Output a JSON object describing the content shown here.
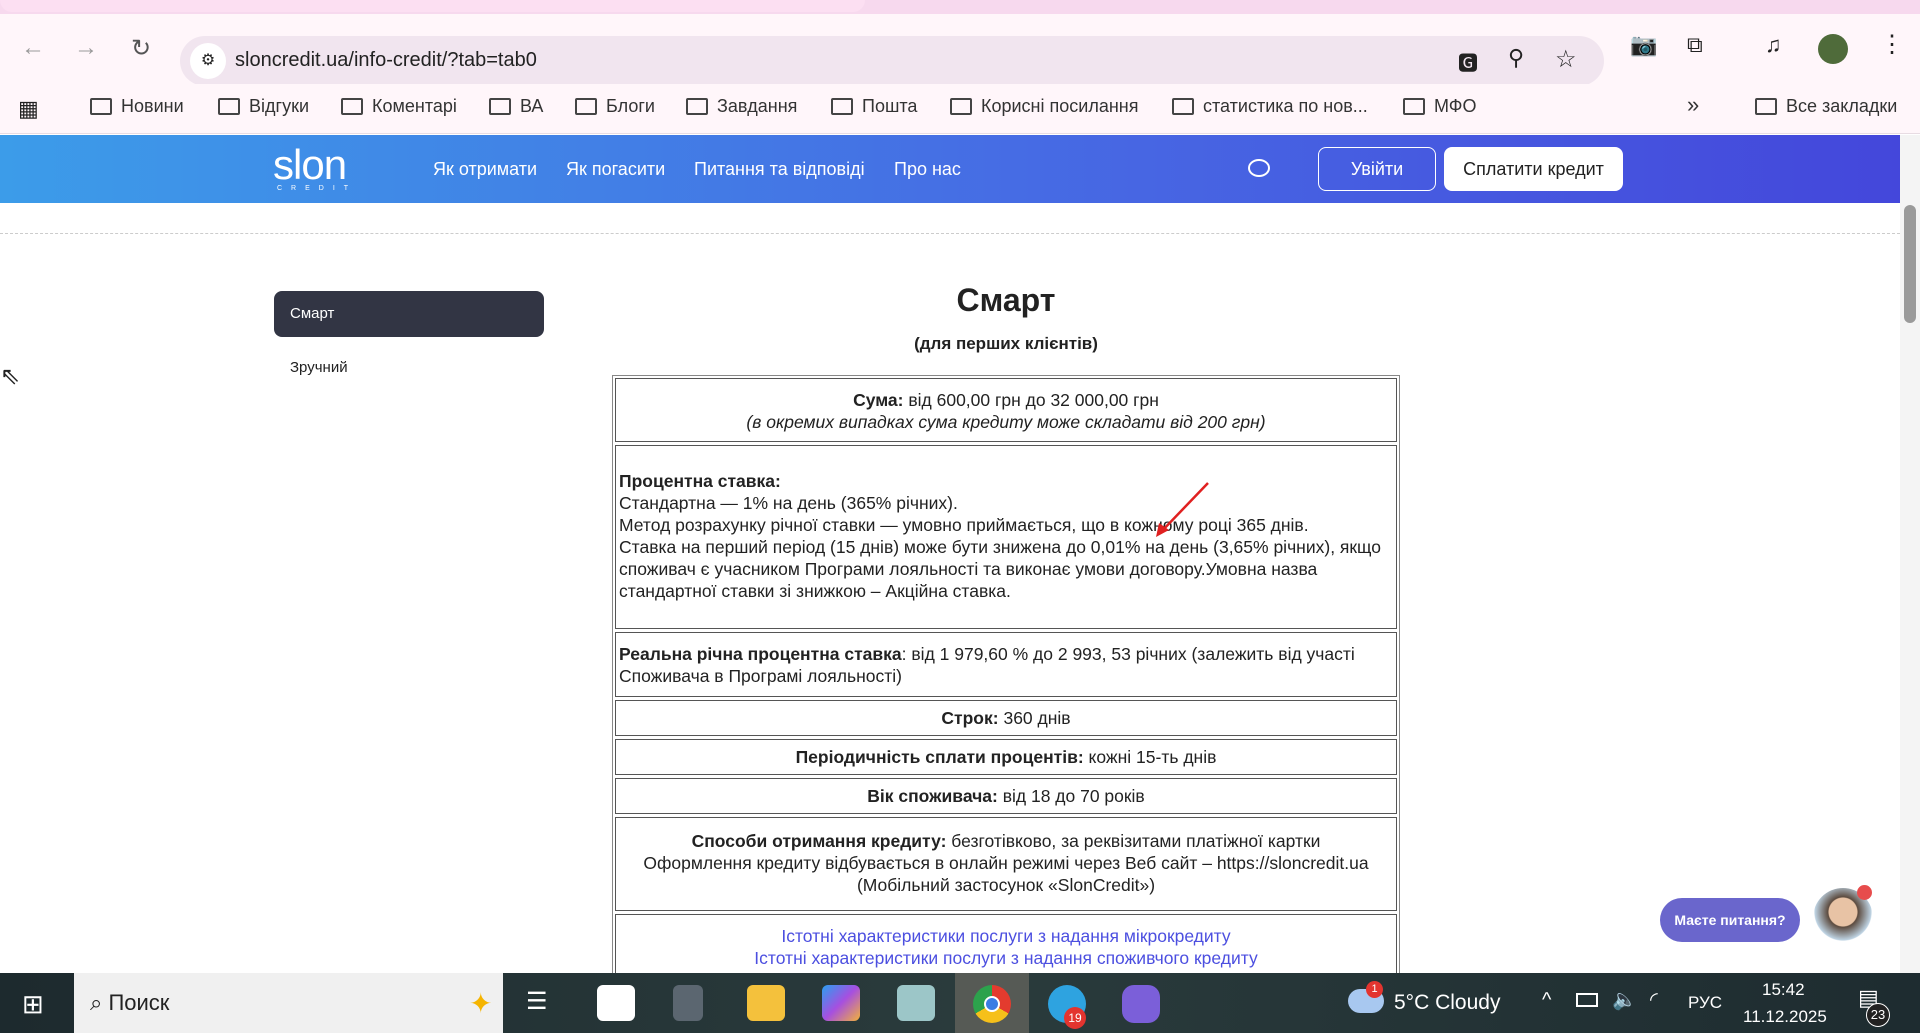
{
  "browser": {
    "url": "sloncredit.ua/info-credit/?tab=tab0",
    "bookmarks": [
      "Новини",
      "Відгуки",
      "Коментарі",
      "ВА",
      "Блоги",
      "Завдання",
      "Пошта",
      "Корисні посилання",
      "статистика по нов...",
      "МФО"
    ],
    "all_bookmarks": "Все закладки",
    "more": "»"
  },
  "site": {
    "logo": "slon",
    "logo_sub": "CREDIT",
    "nav": [
      "Як отримати",
      "Як погасити",
      "Питання та відповіді",
      "Про нас"
    ],
    "login": "Увійти",
    "pay": "Сплатити кредит"
  },
  "sidebar": {
    "items": [
      "Смарт",
      "Зручний"
    ]
  },
  "main": {
    "title": "Смарт",
    "subtitle": "(для перших клієнтів)",
    "sum_label": "Сума:",
    "sum_value": " від 600,00 грн до 32 000,00 грн",
    "sum_note": "(в окремих випадках сума кредиту може складати від 200 грн)",
    "rate_label": "Процентна ставка:",
    "rate_lines": [
      "Стандартна — 1% на день (365% річних).",
      "Метод розрахунку річної ставки — умовно приймається, що в кожному році 365 днів.",
      "Ставка на перший період (15 днів) може бути знижена до 0,01% на день (3,65% річних), якщо споживач є учасником Програми лояльності та виконає умови договору.Умовна назва стандартної ставки зі знижкою – Акційна ставка."
    ],
    "real_label": "Реальна річна процентна ставка",
    "real_value": ": від 1 979,60 % до 2 993, 53 річних (залежить від участі Споживача в Програмі лояльності)",
    "term_label": "Строк:",
    "term_value": " 360 днів",
    "period_label": "Періодичність сплати процентів:",
    "period_value": " кожні 15-ть днів",
    "age_label": "Вік споживача:",
    "age_value": " від 18 до 70 років",
    "methods_label": "Способи отримання кредиту:",
    "methods_value": " безготівково, за реквізитами платіжної картки",
    "methods_line2": "Оформлення кредиту відбувається в онлайн режимі через Веб сайт – https://sloncredit.ua",
    "methods_line3": "(Мобільний застосунок «SlonCredit»)",
    "links": [
      "Істотні характеристики послуги з надання мікрокредиту",
      "Істотні характеристики послуги з надання споживчого кредиту"
    ]
  },
  "chat": {
    "label": "Маєте питання?"
  },
  "taskbar": {
    "search": "Поиск",
    "weather": "5°C  Cloudy",
    "weather_badge": "1",
    "lang": "РУС",
    "time": "15:42",
    "date": "11.12.2025",
    "telegram_badge": "19",
    "notifications": "23"
  }
}
